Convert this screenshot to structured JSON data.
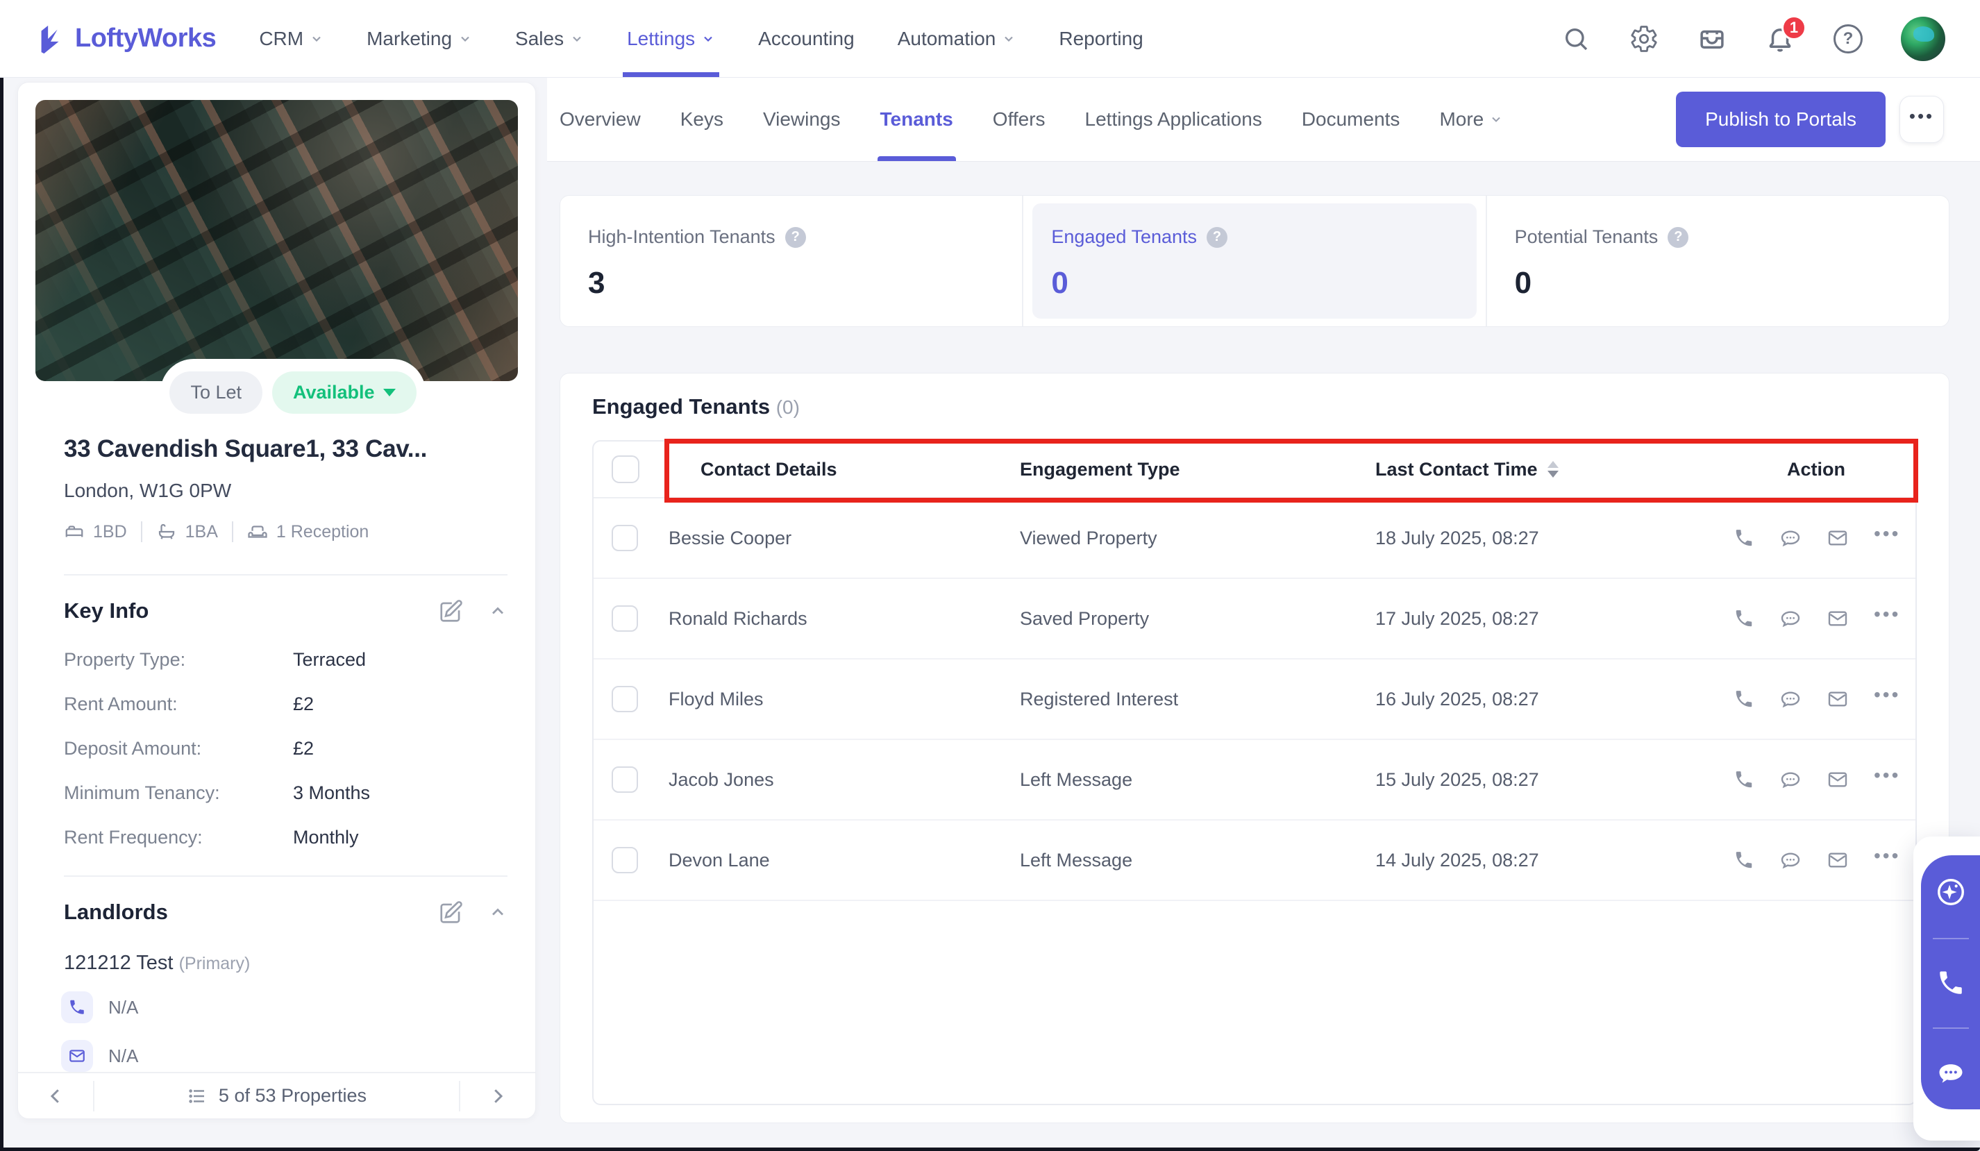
{
  "brand": {
    "name": "LoftyWorks",
    "accent_color": "#5a5cd8"
  },
  "nav": {
    "items": [
      {
        "label": "CRM"
      },
      {
        "label": "Marketing"
      },
      {
        "label": "Sales"
      },
      {
        "label": "Lettings"
      },
      {
        "label": "Accounting"
      },
      {
        "label": "Automation"
      },
      {
        "label": "Reporting"
      }
    ],
    "notification_count": "1",
    "help_glyph": "?"
  },
  "tabs": {
    "items": [
      {
        "label": "Overview"
      },
      {
        "label": "Keys"
      },
      {
        "label": "Viewings"
      },
      {
        "label": "Tenants"
      },
      {
        "label": "Offers"
      },
      {
        "label": "Lettings Applications"
      },
      {
        "label": "Documents"
      },
      {
        "label": "More"
      }
    ],
    "active": "Tenants",
    "publish_button": "Publish to Portals",
    "more_actions_glyph": "•••"
  },
  "property": {
    "listing_badge": "To Let",
    "status_badge": "Available",
    "title": "33 Cavendish Square1, 33 Cav...",
    "address": "London, W1G 0PW",
    "specs": [
      {
        "icon": "bed-icon",
        "label": "1BD"
      },
      {
        "icon": "bath-icon",
        "label": "1BA"
      },
      {
        "icon": "reception-icon",
        "label": "1 Reception"
      }
    ]
  },
  "key_info": {
    "title": "Key Info",
    "rows": [
      {
        "label": "Property Type:",
        "value": "Terraced"
      },
      {
        "label": "Rent Amount:",
        "value": "£2"
      },
      {
        "label": "Deposit Amount:",
        "value": "£2"
      },
      {
        "label": "Minimum Tenancy:",
        "value": "3 Months"
      },
      {
        "label": "Rent Frequency:",
        "value": "Monthly"
      }
    ]
  },
  "landlords": {
    "title": "Landlords",
    "name": "121212 Test",
    "tag": "(Primary)",
    "phone": "N/A",
    "email": "N/A"
  },
  "pagination": {
    "label": "5 of 53 Properties"
  },
  "stats": [
    {
      "label": "High-Intention Tenants",
      "value": "3",
      "selected": false
    },
    {
      "label": "Engaged Tenants",
      "value": "0",
      "selected": true
    },
    {
      "label": "Potential Tenants",
      "value": "0",
      "selected": false
    }
  ],
  "engaged_table": {
    "title": "Engaged Tenants",
    "count": "(0)",
    "columns": [
      "Contact Details",
      "Engagement Type",
      "Last Contact Time",
      "Action"
    ],
    "rows": [
      {
        "name": "Bessie Cooper",
        "engagement": "Viewed Property",
        "time": "18 July 2025, 08:27"
      },
      {
        "name": "Ronald Richards",
        "engagement": "Saved Property",
        "time": "17 July 2025, 08:27"
      },
      {
        "name": "Floyd Miles",
        "engagement": "Registered Interest",
        "time": "16 July 2025, 08:27"
      },
      {
        "name": "Jacob Jones",
        "engagement": "Left Message",
        "time": "15 July 2025, 08:27"
      },
      {
        "name": "Devon Lane",
        "engagement": "Left Message",
        "time": "14 July 2025, 08:27"
      }
    ],
    "row_actions_glyph": "•••"
  },
  "glyphs": {
    "help": "?"
  },
  "annotation_color": "#e8231c"
}
